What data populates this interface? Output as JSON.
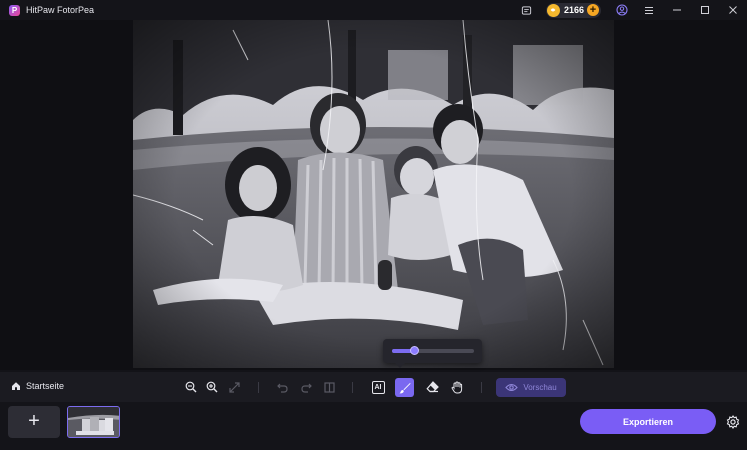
{
  "app": {
    "title": "HitPaw FotorPea",
    "logo_letter": "P"
  },
  "titlebar": {
    "credits": "2166",
    "credits_add": "+"
  },
  "toolbar": {
    "home_label": "Startseite",
    "ai_label": "AI",
    "preview_label": "Vorschau",
    "brush_size": 0.28
  },
  "bottom": {
    "add_label": "+",
    "export_label": "Exportieren"
  },
  "colors": {
    "accent": "#7a5df5",
    "active_tool": "#7a68f0",
    "coin": "#f5b82e"
  }
}
